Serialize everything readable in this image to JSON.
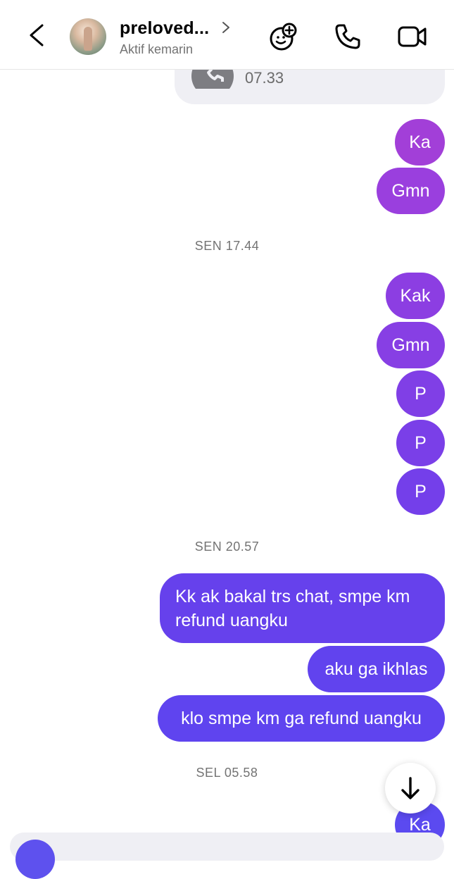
{
  "header": {
    "contact_name": "preloved...",
    "status": "Aktif kemarin"
  },
  "call": {
    "time": "07.33"
  },
  "messages": [
    {
      "text": "Ka",
      "color": "#a23fd8"
    },
    {
      "text": "Gmn",
      "color": "#9a3fde"
    },
    {
      "text": "Kak",
      "color": "#8c3ee2"
    },
    {
      "text": "Gmn",
      "color": "#873fe4"
    },
    {
      "text": "P",
      "color": "#803fe6"
    },
    {
      "text": "P",
      "color": "#7a3fe8"
    },
    {
      "text": "P",
      "color": "#743fea"
    },
    {
      "text": "Kk ak bakal trs chat, smpe km refund uangku",
      "color": "#6641ec"
    },
    {
      "text": "aku ga ikhlas",
      "color": "#6143ee"
    },
    {
      "text": "klo smpe km ga refund uangku",
      "color": "#5f44ef"
    },
    {
      "text": "Ka",
      "color": "#5b4af0"
    }
  ],
  "timestamps": [
    "SEN 17.44",
    "SEN 20.57",
    "SEL 05.58"
  ],
  "icons": {
    "back": "chevron-left-icon",
    "sticker": "sticker-add-icon",
    "call": "phone-icon",
    "video": "video-camera-icon",
    "scroll": "arrow-down-icon"
  }
}
